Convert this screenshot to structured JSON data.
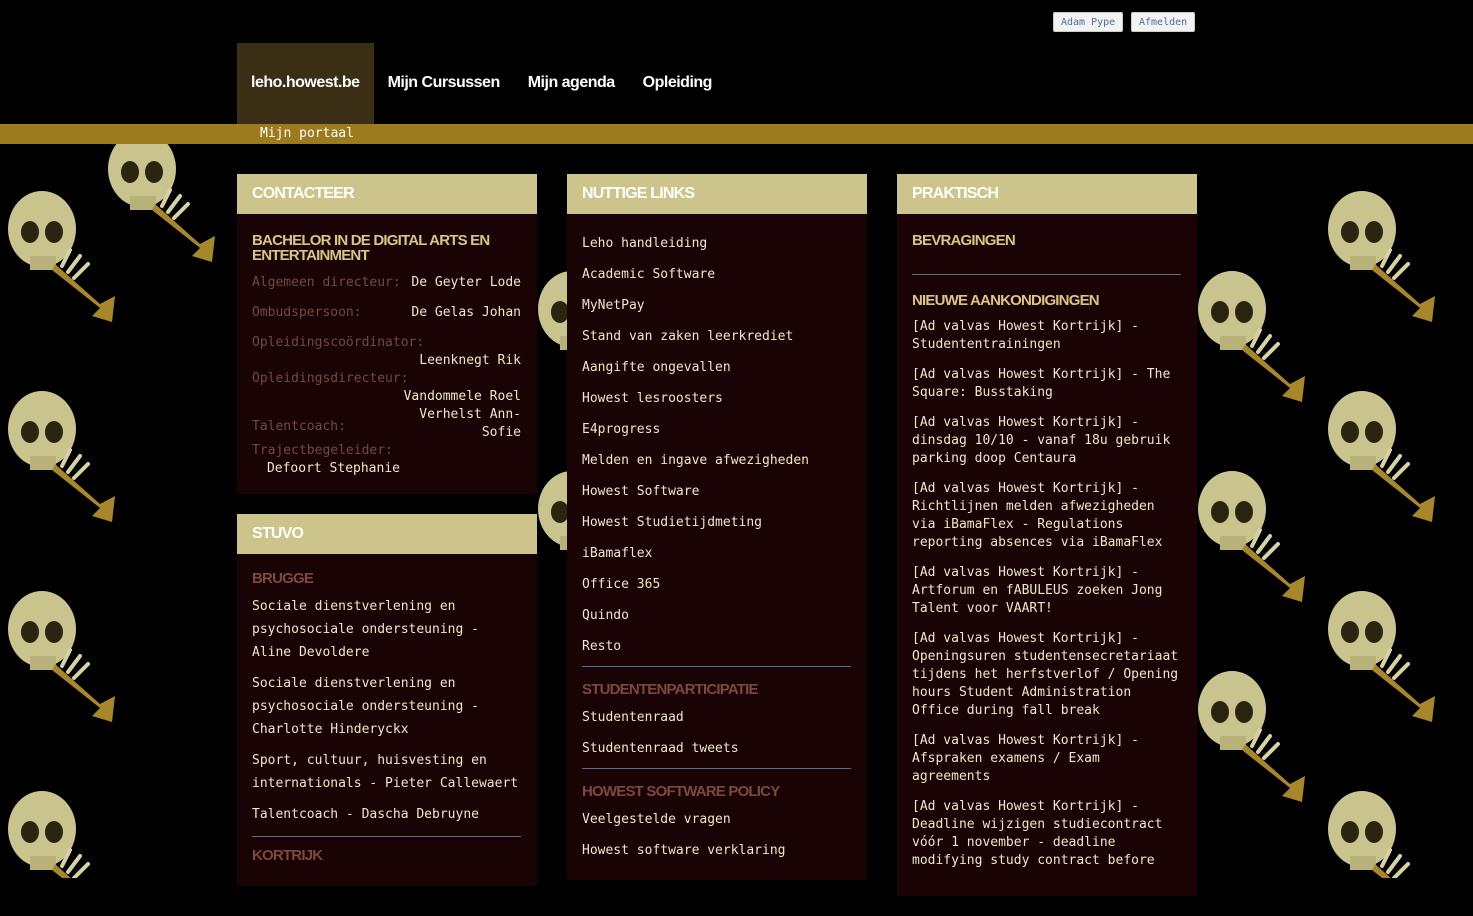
{
  "header": {
    "user_name": "Adam Pype",
    "logout_label": "Afmelden",
    "nav": [
      "leho.howest.be",
      "Mijn Cursussen",
      "Mijn agenda",
      "Opleiding"
    ],
    "subnav": "Mijn portaal"
  },
  "contact": {
    "title": "CONTACTEER",
    "program": "BACHELOR IN DE DIGITAL ARTS EN ENTERTAINMENT",
    "rows": [
      {
        "label": "Algemeen directeur:",
        "value": "De Geyter Lode"
      },
      {
        "label": "Ombudspersoon:",
        "value": "De Gelas Johan"
      },
      {
        "label": "Opleidingscoördinator:",
        "value": "Leenknegt Rik"
      },
      {
        "label": "Opleidingsdirecteur:",
        "value": "Vandommele Roel"
      },
      {
        "label": "Talentcoach:",
        "value": "Verhelst Ann-Sofie"
      },
      {
        "label": "Trajectbegeleider:",
        "value": "Defoort Stephanie"
      }
    ]
  },
  "stuvo": {
    "title": "STUVO",
    "brugge": "BRUGGE",
    "items": [
      "Sociale dienstverlening en psychosociale ondersteuning - Aline Devoldere",
      "Sociale dienstverlening en psychosociale ondersteuning - Charlotte Hinderyckx",
      "Sport, cultuur, huisvesting en internationals - Pieter Callewaert",
      "Talentcoach - Dascha Debruyne"
    ],
    "kortrijk": "KORTRIJK"
  },
  "links": {
    "title": "NUTTIGE LINKS",
    "items": [
      "Leho handleiding",
      "Academic Software",
      "MyNetPay",
      "Stand van zaken leerkrediet",
      "Aangifte ongevallen",
      "Howest lesroosters",
      "E4progress",
      "Melden en ingave afwezigheden",
      "Howest Software",
      "Howest Studietijdmeting",
      "iBamaflex",
      "Office 365",
      "Quindo",
      "Resto"
    ],
    "participation_title": "STUDENTENPARTICIPATIE",
    "participation": [
      "Studentenraad",
      "Studentenraad tweets"
    ],
    "policy_title": "HOWEST SOFTWARE POLICY",
    "policy": [
      "Veelgestelde vragen",
      "Howest software verklaring"
    ]
  },
  "practical": {
    "title": "PRAKTISCH",
    "surveys": "BEVRAGINGEN",
    "announcements_title": "NIEUWE AANKONDIGINGEN",
    "announcements": [
      "[Ad valvas Howest Kortrijk] - Studententrainingen",
      "[Ad valvas Howest Kortrijk] - The Square: Busstaking",
      "[Ad valvas Howest Kortrijk] - dinsdag 10/10 - vanaf 18u gebruik parking doop Centaura",
      "[Ad valvas Howest Kortrijk] - Richtlijnen melden afwezigheden via iBamaFlex - Regulations reporting absences via iBamaFlex",
      "[Ad valvas Howest Kortrijk] - Artforum en fABULEUS zoeken Jong Talent voor VAART!",
      "[Ad valvas Howest Kortrijk] - Openingsuren studentensecretariaat tijdens het herfstverlof / Opening hours Student Administration Office during fall break",
      "[Ad valvas Howest Kortrijk] - Afspraken examens / Exam agreements",
      "[Ad valvas Howest Kortrijk] - Deadline wijzigen studiecontract vóór 1 november - deadline modifying study contract before"
    ]
  }
}
